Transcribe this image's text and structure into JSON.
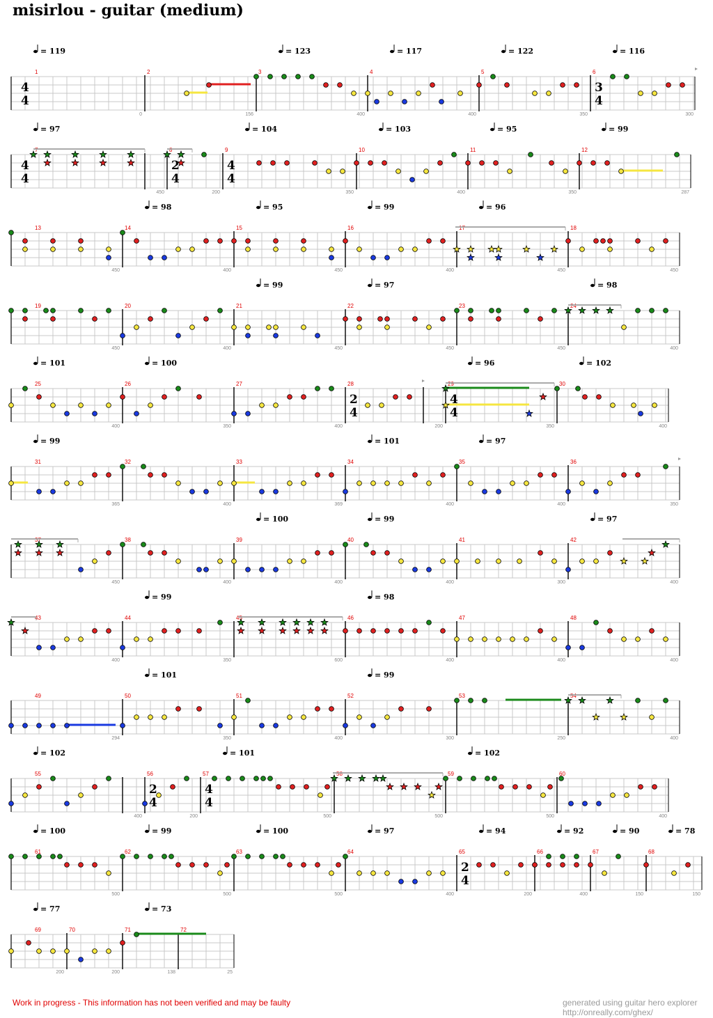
{
  "title": "misirlou - guitar (medium)",
  "footer": {
    "warning": "Work in progress - This information has not been verified and may be faulty",
    "credit_line1": "generated using guitar hero explorer",
    "credit_line2": "http://onreally.com/ghex/"
  },
  "colors": {
    "green": "#1a8a1a",
    "red": "#e02020",
    "yellow": "#f5e640",
    "blue": "#1a3ae0",
    "grid": "#c8c8c8",
    "measure_number": "#e00000",
    "phrase_bar": "#aaaaaa"
  },
  "rows": [
    {
      "tempos": [
        {
          "m": 1,
          "bpm": "119"
        },
        {
          "m": 3,
          "bpm": "123"
        },
        {
          "m": 4,
          "bpm": "117"
        },
        {
          "m": 5,
          "bpm": "122"
        },
        {
          "m": 6,
          "bpm": "116"
        }
      ],
      "measures": [
        {
          "n": "1",
          "len": "",
          "ts": "4/4"
        },
        {
          "n": "2",
          "len": "0"
        },
        {
          "n": "3",
          "len": "156"
        },
        {
          "n": "4",
          "len": "400"
        },
        {
          "n": "5",
          "len": "400"
        },
        {
          "n": "6",
          "len": "350",
          "ts": "3/4"
        }
      ],
      "end_len": "300"
    },
    {
      "tempos": [
        {
          "m": 7,
          "bpm": "97"
        },
        {
          "m": 9,
          "bpm": "104"
        },
        {
          "m": 10,
          "bpm": "103"
        },
        {
          "m": 11,
          "bpm": "95"
        },
        {
          "m": 12,
          "bpm": "99"
        }
      ],
      "measures": [
        {
          "n": "7",
          "len": "",
          "ts": "4/4"
        },
        {
          "n": "8",
          "len": "450",
          "ts": "2/4"
        },
        {
          "n": "9",
          "len": "200",
          "ts": "4/4"
        },
        {
          "n": "10",
          "len": "350"
        },
        {
          "n": "11",
          "len": "400"
        },
        {
          "n": "12",
          "len": "350"
        }
      ],
      "end_len": "287"
    },
    {
      "tempos": [
        {
          "m": 14,
          "bpm": "98"
        },
        {
          "m": 15,
          "bpm": "95"
        },
        {
          "m": 16,
          "bpm": "99"
        },
        {
          "m": 17,
          "bpm": "96"
        }
      ],
      "measures": [
        {
          "n": "13",
          "len": ""
        },
        {
          "n": "14",
          "len": "450"
        },
        {
          "n": "15",
          "len": "400"
        },
        {
          "n": "16",
          "len": "450"
        },
        {
          "n": "17",
          "len": "400"
        },
        {
          "n": "18",
          "len": "450"
        }
      ],
      "end_len": "450"
    },
    {
      "tempos": [
        {
          "m": 21,
          "bpm": "99"
        },
        {
          "m": 22,
          "bpm": "97"
        },
        {
          "m": 24,
          "bpm": "98"
        }
      ],
      "measures": [
        {
          "n": "19",
          "len": ""
        },
        {
          "n": "20",
          "len": "450"
        },
        {
          "n": "21",
          "len": "400"
        },
        {
          "n": "22",
          "len": "450"
        },
        {
          "n": "23",
          "len": "450"
        },
        {
          "n": "24",
          "len": "450"
        }
      ],
      "end_len": "400"
    },
    {
      "tempos": [
        {
          "m": 25,
          "bpm": "101"
        },
        {
          "m": 26,
          "bpm": "100"
        },
        {
          "m": 29,
          "bpm": "96"
        },
        {
          "m": 30,
          "bpm": "102"
        }
      ],
      "measures": [
        {
          "n": "25",
          "len": ""
        },
        {
          "n": "26",
          "len": "400"
        },
        {
          "n": "27",
          "len": "350"
        },
        {
          "n": "28",
          "len": "400",
          "ts": "2/4"
        },
        {
          "n": "29",
          "len": "200",
          "ts": "4/4"
        },
        {
          "n": "30",
          "len": "350"
        }
      ],
      "end_len": "400"
    },
    {
      "tempos": [
        {
          "m": 31,
          "bpm": "99"
        },
        {
          "m": 34,
          "bpm": "101"
        },
        {
          "m": 35,
          "bpm": "97"
        }
      ],
      "measures": [
        {
          "n": "31",
          "len": ""
        },
        {
          "n": "32",
          "len": "365"
        },
        {
          "n": "33",
          "len": "400"
        },
        {
          "n": "34",
          "len": "369"
        },
        {
          "n": "35",
          "len": "400"
        },
        {
          "n": "36",
          "len": "400"
        }
      ],
      "end_len": "350"
    },
    {
      "tempos": [
        {
          "m": 39,
          "bpm": "100"
        },
        {
          "m": 40,
          "bpm": "99"
        },
        {
          "m": 42,
          "bpm": "97"
        }
      ],
      "measures": [
        {
          "n": "37",
          "len": ""
        },
        {
          "n": "38",
          "len": "450"
        },
        {
          "n": "39",
          "len": "400"
        },
        {
          "n": "40",
          "len": "400"
        },
        {
          "n": "41",
          "len": "400"
        },
        {
          "n": "42",
          "len": "300"
        }
      ],
      "end_len": "400"
    },
    {
      "tempos": [
        {
          "m": 44,
          "bpm": "99"
        },
        {
          "m": 46,
          "bpm": "98"
        }
      ],
      "measures": [
        {
          "n": "43",
          "len": ""
        },
        {
          "n": "44",
          "len": "400"
        },
        {
          "n": "45",
          "len": "350"
        },
        {
          "n": "46",
          "len": "600"
        },
        {
          "n": "47",
          "len": "400"
        },
        {
          "n": "48",
          "len": "400"
        }
      ],
      "end_len": "400"
    },
    {
      "tempos": [
        {
          "m": 50,
          "bpm": "101"
        },
        {
          "m": 52,
          "bpm": "99"
        }
      ],
      "measures": [
        {
          "n": "49",
          "len": ""
        },
        {
          "n": "50",
          "len": "294"
        },
        {
          "n": "51",
          "len": "350"
        },
        {
          "n": "52",
          "len": "400"
        },
        {
          "n": "53",
          "len": "300"
        },
        {
          "n": "54",
          "len": "250"
        }
      ],
      "end_len": "400"
    },
    {
      "tempos": [
        {
          "m": 55,
          "bpm": "102"
        },
        {
          "m": 57,
          "bpm": "101"
        },
        {
          "m": 59,
          "bpm": "102"
        }
      ],
      "measures": [
        {
          "n": "55",
          "len": ""
        },
        {
          "n": "56",
          "len": "400",
          "ts": "2/4"
        },
        {
          "n": "57",
          "len": "200",
          "ts": "4/4"
        },
        {
          "n": "58",
          "len": "500"
        },
        {
          "n": "59",
          "len": "500"
        },
        {
          "n": "60",
          "len": "500"
        }
      ],
      "end_len": "400"
    },
    {
      "tempos": [
        {
          "m": 61,
          "bpm": "100"
        },
        {
          "m": 62,
          "bpm": "99"
        },
        {
          "m": 63,
          "bpm": "100"
        },
        {
          "m": 64,
          "bpm": "97"
        },
        {
          "m": 65,
          "bpm": "94"
        },
        {
          "m": 66,
          "bpm": "92"
        },
        {
          "m": 67,
          "bpm": "90"
        },
        {
          "m": 68,
          "bpm": "78"
        }
      ],
      "measures": [
        {
          "n": "61",
          "len": ""
        },
        {
          "n": "62",
          "len": "500"
        },
        {
          "n": "63",
          "len": "500"
        },
        {
          "n": "64",
          "len": "500"
        },
        {
          "n": "65",
          "len": "400",
          "ts": "2/4"
        },
        {
          "n": "66",
          "len": "200"
        },
        {
          "n": "67",
          "len": "400"
        },
        {
          "n": "68",
          "len": "150"
        }
      ],
      "end_len": "150"
    },
    {
      "tempos": [
        {
          "m": 69,
          "bpm": "77"
        },
        {
          "m": 71,
          "bpm": "73"
        }
      ],
      "measures": [
        {
          "n": "69",
          "len": ""
        },
        {
          "n": "70",
          "len": "200"
        },
        {
          "n": "71",
          "len": "200"
        },
        {
          "n": "72",
          "len": "138"
        }
      ],
      "end_len": "25"
    }
  ]
}
